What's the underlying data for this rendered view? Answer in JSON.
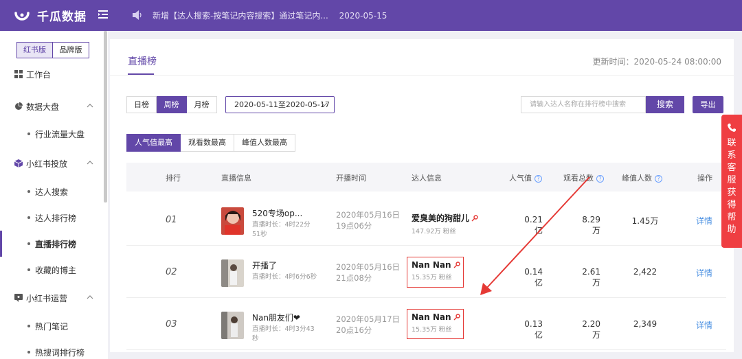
{
  "app": {
    "name": "千瓜数据",
    "notice": "新增【达人搜索-按笔记内容搜索】通过笔记内...",
    "notice_date": "2020-05-15"
  },
  "sidebar": {
    "versions": [
      "红书版",
      "品牌版"
    ],
    "items": [
      {
        "label": "工作台",
        "icon": "grid-icon"
      },
      {
        "label": "数据大盘",
        "icon": "pie-chart-icon"
      },
      {
        "label": "行业流量大盘"
      },
      {
        "label": "小红书投放",
        "icon": "cube-icon"
      },
      {
        "label": "达人搜索"
      },
      {
        "label": "达人排行榜"
      },
      {
        "label": "直播排行榜"
      },
      {
        "label": "收藏的博主"
      },
      {
        "label": "小红书运营",
        "icon": "chat-icon"
      },
      {
        "label": "热门笔记"
      },
      {
        "label": "热搜词排行榜"
      }
    ]
  },
  "page": {
    "tab": "直播榜",
    "update_time": "更新时间：2020-05-24 08:00:00"
  },
  "filters": {
    "periods": [
      "日榜",
      "周榜",
      "月榜"
    ],
    "active_period": "周榜",
    "date_range": "2020-05-11至2020-05-17",
    "search_placeholder": "请输入达人名称在排行榜中搜索",
    "search_button": "搜索",
    "export_button": "导出",
    "sorts": [
      "人气值最高",
      "观看数最高",
      "峰值人数最高"
    ],
    "active_sort": "人气值最高"
  },
  "table": {
    "headers": {
      "rank": "排行",
      "live_info": "直播信息",
      "start_time": "开播时间",
      "talent_info": "达人信息",
      "popularity": "人气值",
      "total_views": "观看总数",
      "peak_viewers": "峰值人数",
      "actions": "操作"
    },
    "rows": [
      {
        "rank": "01",
        "title": "520专场op...",
        "duration": "直播时长：4时22分51秒",
        "start_date": "2020年05月16日",
        "start_clock": "19点06分",
        "talent": "爱臭美的狗甜儿",
        "fans": "147.92万 粉丝",
        "popularity": "0.21亿",
        "views": "8.29万",
        "peak": "1.45万",
        "action": "详情"
      },
      {
        "rank": "02",
        "title": "开播了",
        "duration": "直播时长：4时6分6秒",
        "start_date": "2020年05月16日",
        "start_clock": "21点08分",
        "talent": "Nan Nan",
        "fans": "15.35万 粉丝",
        "popularity": "0.14亿",
        "views": "2.61万",
        "peak": "2,422",
        "action": "详情"
      },
      {
        "rank": "03",
        "title": "Nan朋友们❤",
        "duration": "直播时长：4时3分43秒",
        "start_date": "2020年05月17日",
        "start_clock": "20点16分",
        "talent": "Nan Nan",
        "fans": "15.35万 粉丝",
        "popularity": "0.13亿",
        "views": "2.20万",
        "peak": "2,349",
        "action": "详情"
      }
    ]
  },
  "contact": {
    "label": "联系客服获得帮助"
  },
  "colors": {
    "brand": "#6247a8",
    "link": "#4a90e2",
    "highlight": "#e53935",
    "contact": "#ef3e42"
  }
}
